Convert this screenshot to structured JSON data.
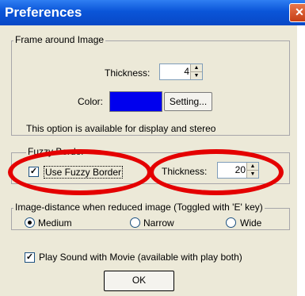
{
  "window": {
    "title": "Preferences",
    "close_glyph": "✕"
  },
  "frame_group": {
    "legend": "Frame around Image",
    "thickness_label": "Thickness:",
    "thickness_value": "4",
    "color_label": "Color:",
    "swatch_color": "#0000ee",
    "setting_button": "Setting...",
    "note": "This option is available for display and stereo"
  },
  "fuzzy_group": {
    "legend": "Fuzzy Border",
    "use_checkbox_label": "Use Fuzzy Border",
    "use_checked": true,
    "thickness_label": "Thickness:",
    "thickness_value": "20"
  },
  "distance_group": {
    "legend": "Image-distance when reduced image (Toggled with 'E' key)",
    "options": [
      "Medium",
      "Narrow",
      "Wide"
    ],
    "selected": "Medium"
  },
  "play_sound": {
    "label": "Play Sound with Movie (available with play both)",
    "checked": true
  },
  "ok_button": "OK",
  "colors": {
    "highlight": "#e40000",
    "title_bar": "#0a55d8",
    "dialog_bg": "#ece9d8"
  }
}
